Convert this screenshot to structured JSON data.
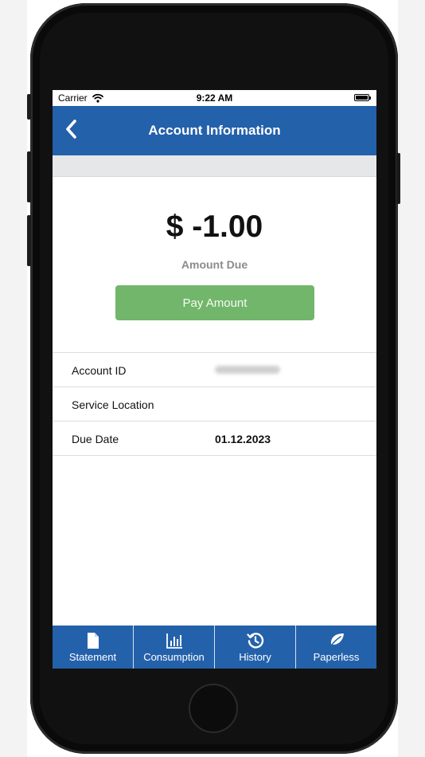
{
  "status_bar": {
    "carrier": "Carrier",
    "time": "9:22 AM",
    "wifi_icon": "wifi-icon",
    "battery_icon": "battery-icon",
    "battery_level": 1.0
  },
  "nav_bar": {
    "back_icon": "chevron-left-icon",
    "title": "Account Information"
  },
  "amount": {
    "value": "$ -1.00",
    "label": "Amount Due",
    "pay_button_label": "Pay Amount"
  },
  "info_rows": [
    {
      "label": "Account ID",
      "value": ""
    },
    {
      "label": "Service Location",
      "value": ""
    },
    {
      "label": "Due Date",
      "value": "01.12.2023"
    }
  ],
  "tab_bar": {
    "items": [
      {
        "label": "Statement",
        "icon": "document-icon"
      },
      {
        "label": "Consumption",
        "icon": "bar-chart-icon"
      },
      {
        "label": "History",
        "icon": "history-icon"
      },
      {
        "label": "Paperless",
        "icon": "leaf-icon"
      }
    ]
  },
  "colors": {
    "brand_blue": "#2461ab",
    "pay_green": "#72b66b",
    "muted_gray": "#8b8b8b",
    "strip_gray": "#e6e7e9"
  }
}
